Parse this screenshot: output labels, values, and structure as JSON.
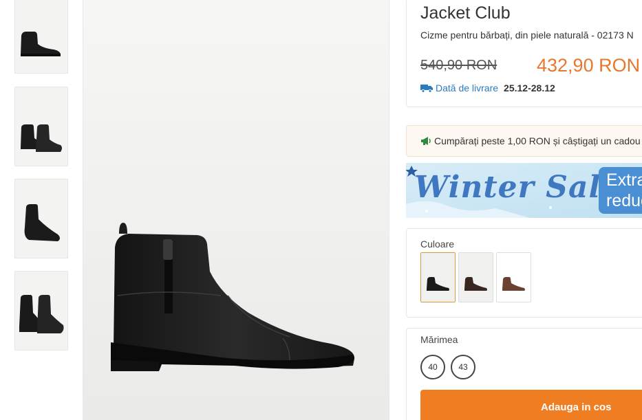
{
  "product": {
    "brand": "Jacket Club",
    "subtitle": "Cizme pentru bărbați, din piele naturală - 02173 N",
    "old_price": "540,90 RON",
    "new_price": "432,90 RON",
    "delivery_label": "Dată de livrare",
    "delivery_date": "25.12-28.12"
  },
  "promo": {
    "text": "Cumpărați peste 1,00 RON și câștigați un cadou"
  },
  "banner": {
    "title": "Winter Sale",
    "extra_line1": "Extra",
    "extra_line2": "reduceri"
  },
  "color": {
    "label": "Culoare",
    "options": [
      "black",
      "dark-brown",
      "brown"
    ],
    "selected": "black"
  },
  "size": {
    "label": "Mărimea",
    "options": [
      "40",
      "43"
    ]
  },
  "cart": {
    "button_label": "Adauga in cos"
  },
  "colors": {
    "accent": "#ef7e23",
    "price": "#e8772e",
    "link": "#2b7bbf"
  }
}
